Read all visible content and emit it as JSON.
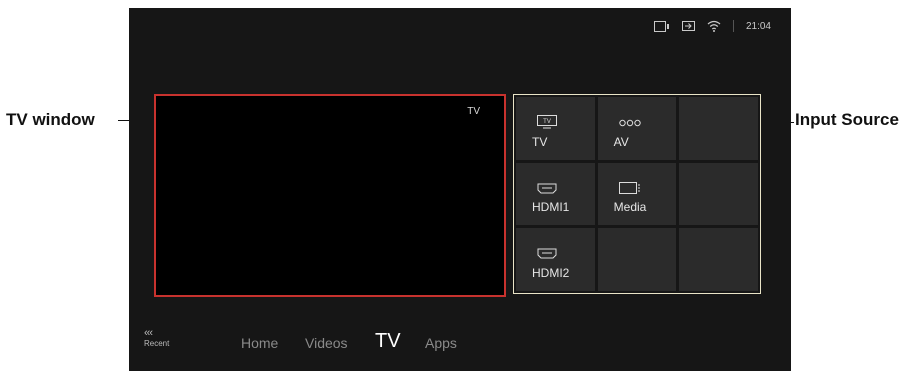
{
  "annotations": {
    "tv_window": "TV window",
    "input_source": "Input Source"
  },
  "status": {
    "time": "21:04",
    "icons": [
      "media-icon",
      "input-icon",
      "wifi-icon"
    ]
  },
  "tv_window": {
    "tag": "TV",
    "border_color": "#c8322e"
  },
  "sources": [
    {
      "label": "TV",
      "icon": "tv-icon"
    },
    {
      "label": "AV",
      "icon": "av-icon"
    },
    {
      "label": "",
      "icon": ""
    },
    {
      "label": "HDMI1",
      "icon": "hdmi-icon"
    },
    {
      "label": "Media",
      "icon": "media-icon"
    },
    {
      "label": "",
      "icon": ""
    },
    {
      "label": "HDMI2",
      "icon": "hdmi-icon"
    },
    {
      "label": "",
      "icon": ""
    },
    {
      "label": "",
      "icon": ""
    }
  ],
  "nav": {
    "recent_arrows": "‹‹‹",
    "recent_label": "Recent",
    "items": [
      "Home",
      "Videos",
      "TV",
      "Apps"
    ],
    "active": "TV"
  }
}
